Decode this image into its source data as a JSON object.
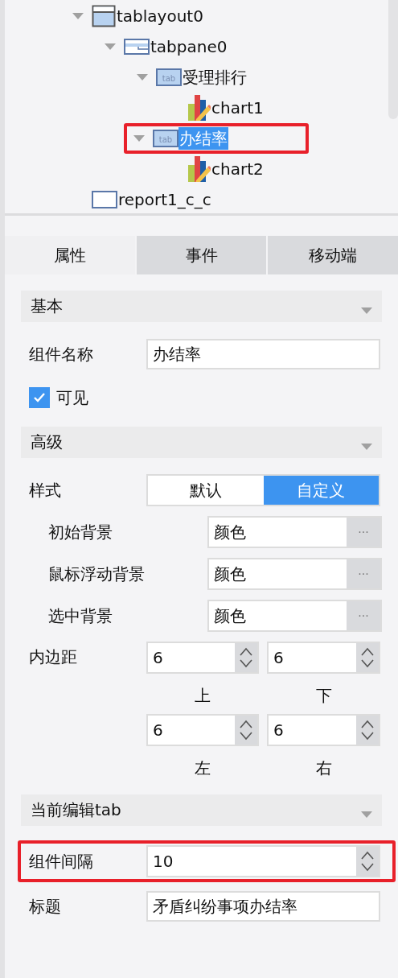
{
  "tree": [
    {
      "label": "tablayout0",
      "kind": "tablayout",
      "expanded": true,
      "selected": false,
      "highlighted": false,
      "children": [
        {
          "label": "tabpane0",
          "kind": "tabpane",
          "expanded": true,
          "selected": false,
          "highlighted": false,
          "children": [
            {
              "label": "受理排行",
              "kind": "tab",
              "icon_text": "tab",
              "expanded": true,
              "selected": false,
              "highlighted": false,
              "children": [
                {
                  "label": "chart1",
                  "kind": "chart",
                  "selected": false,
                  "highlighted": false
                }
              ]
            },
            {
              "label": "办结率",
              "kind": "tab",
              "icon_text": "tab",
              "expanded": true,
              "selected": true,
              "highlighted": true,
              "children": [
                {
                  "label": "chart2",
                  "kind": "chart",
                  "selected": false,
                  "highlighted": false
                }
              ]
            }
          ]
        }
      ]
    },
    {
      "label": "report1_c_c",
      "kind": "report",
      "selected": false,
      "highlighted": false
    }
  ],
  "tabs": [
    {
      "label": "属性",
      "selected": true
    },
    {
      "label": "事件",
      "selected": false
    },
    {
      "label": "移动端",
      "selected": false
    }
  ],
  "sections": [
    {
      "title": "基本",
      "expanded": true,
      "rows": [
        {
          "kind": "text",
          "label": "组件名称",
          "value": "办结率",
          "highlighted": false
        },
        {
          "kind": "checkbox",
          "label": "可见",
          "checked": true
        }
      ]
    },
    {
      "title": "高级",
      "expanded": true,
      "rows": [
        {
          "kind": "segmented",
          "label": "样式",
          "options": [
            {
              "label": "默认",
              "selected": false
            },
            {
              "label": "自定义",
              "selected": true
            }
          ]
        },
        {
          "kind": "color",
          "label": "初始背景",
          "value": "颜色",
          "button": "···"
        },
        {
          "kind": "color",
          "label": "鼠标浮动背景",
          "value": "颜色",
          "button": "···"
        },
        {
          "kind": "color",
          "label": "选中背景",
          "value": "颜色",
          "button": "···"
        },
        {
          "kind": "padding",
          "label": "内边距",
          "fields": [
            {
              "value": "6",
              "caption": "上"
            },
            {
              "value": "6",
              "caption": "下"
            },
            {
              "value": "6",
              "caption": "左"
            },
            {
              "value": "6",
              "caption": "右"
            }
          ]
        }
      ]
    },
    {
      "title": "当前编辑tab",
      "expanded": true,
      "rows": [
        {
          "kind": "spinner",
          "label": "组件间隔",
          "value": "10",
          "highlighted": true
        },
        {
          "kind": "text",
          "label": "标题",
          "value": "矛盾纠纷事项办结率",
          "highlighted": false
        }
      ]
    }
  ]
}
